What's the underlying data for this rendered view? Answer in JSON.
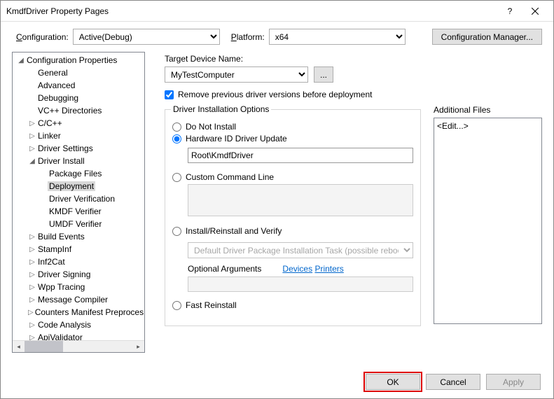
{
  "titlebar": {
    "title": "KmdfDriver Property Pages"
  },
  "configRow": {
    "configLabel": "Configuration:",
    "configValue": "Active(Debug)",
    "platformLabel": "Platform:",
    "platformValue": "x64",
    "managerBtn": "Configuration Manager..."
  },
  "tree": {
    "root": "Configuration Properties",
    "items": [
      {
        "label": "General",
        "indent": 1,
        "caret": ""
      },
      {
        "label": "Advanced",
        "indent": 1,
        "caret": ""
      },
      {
        "label": "Debugging",
        "indent": 1,
        "caret": ""
      },
      {
        "label": "VC++ Directories",
        "indent": 1,
        "caret": ""
      },
      {
        "label": "C/C++",
        "indent": 1,
        "caret": "▷"
      },
      {
        "label": "Linker",
        "indent": 1,
        "caret": "▷"
      },
      {
        "label": "Driver Settings",
        "indent": 1,
        "caret": "▷"
      },
      {
        "label": "Driver Install",
        "indent": 1,
        "caret": "◢"
      },
      {
        "label": "Package Files",
        "indent": 2,
        "caret": ""
      },
      {
        "label": "Deployment",
        "indent": 2,
        "caret": "",
        "selected": true
      },
      {
        "label": "Driver Verification",
        "indent": 2,
        "caret": ""
      },
      {
        "label": "KMDF Verifier",
        "indent": 2,
        "caret": ""
      },
      {
        "label": "UMDF Verifier",
        "indent": 2,
        "caret": ""
      },
      {
        "label": "Build Events",
        "indent": 1,
        "caret": "▷"
      },
      {
        "label": "StampInf",
        "indent": 1,
        "caret": "▷"
      },
      {
        "label": "Inf2Cat",
        "indent": 1,
        "caret": "▷"
      },
      {
        "label": "Driver Signing",
        "indent": 1,
        "caret": "▷"
      },
      {
        "label": "Wpp Tracing",
        "indent": 1,
        "caret": "▷"
      },
      {
        "label": "Message Compiler",
        "indent": 1,
        "caret": "▷"
      },
      {
        "label": "Counters Manifest Preproces",
        "indent": 1,
        "caret": "▷"
      },
      {
        "label": "Code Analysis",
        "indent": 1,
        "caret": "▷"
      },
      {
        "label": "ApiValidator",
        "indent": 1,
        "caret": "▷"
      }
    ]
  },
  "form": {
    "targetLabel": "Target Device Name:",
    "targetValue": "MyTestComputer",
    "browse": "...",
    "removeCheckbox": "Remove previous driver versions before deployment",
    "installGroup": "Driver Installation Options",
    "radios": {
      "doNotInstall": "Do Not Install",
      "hwId": "Hardware ID Driver Update",
      "hwIdValue": "Root\\KmdfDriver",
      "customCmd": "Custom Command Line",
      "installVerify": "Install/Reinstall and Verify",
      "installTask": "Default Driver Package Installation Task (possible reboot)",
      "optArgs": "Optional Arguments",
      "devicesLink": "Devices",
      "printersLink": "Printers",
      "fastReinstall": "Fast Reinstall"
    },
    "additionalFiles": "Additional Files",
    "editPlaceholder": "<Edit...>"
  },
  "footer": {
    "ok": "OK",
    "cancel": "Cancel",
    "apply": "Apply"
  }
}
